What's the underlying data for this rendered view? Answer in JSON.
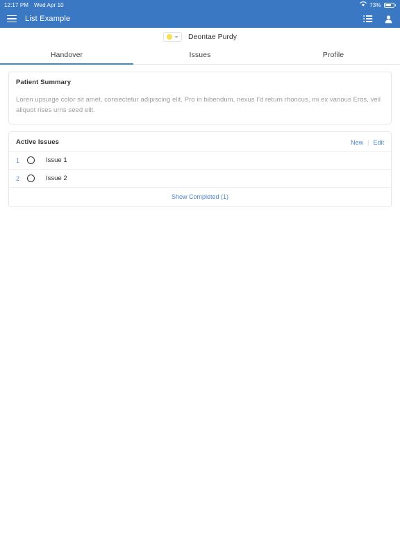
{
  "status_bar": {
    "time": "12:17 PM",
    "date": "Wed Apr 10",
    "battery_percent": "73%",
    "wifi_icon": "wifi-icon",
    "battery_icon": "battery-icon",
    "background_color": "#3b78c3"
  },
  "app_bar": {
    "menu_icon": "hamburger-menu-icon",
    "title": "List Example",
    "list_icon": "view-list-icon",
    "account_icon": "account-person-icon",
    "background_color": "#3b78c3"
  },
  "patient_header": {
    "status_dot_color": "#f5e050",
    "status_dot_icon": "status-dot-icon",
    "chevron_icon": "chevron-down-icon",
    "name": "Deontae Purdy"
  },
  "tabs": [
    {
      "label": "Handover",
      "active": true
    },
    {
      "label": "Issues",
      "active": false
    },
    {
      "label": "Profile",
      "active": false
    }
  ],
  "tab_accent_color": "#4285c8",
  "patient_summary": {
    "title": "Patient Summary",
    "text": "Loren upsurge color sit amet, consectetur adipiscing elit. Pro in bibendum, nexus I'd return rhoncus, mi ex various Eros, veil aliquot rises urns seed elit."
  },
  "active_issues": {
    "title": "Active Issues",
    "new_label": "New",
    "separator": "|",
    "edit_label": "Edit",
    "rows": [
      {
        "number": "1",
        "label": "Issue 1",
        "checked": false
      },
      {
        "number": "2",
        "label": "Issue 2",
        "checked": false
      }
    ],
    "show_completed_label": "Show Completed (1)",
    "link_color": "#4a86c8"
  }
}
